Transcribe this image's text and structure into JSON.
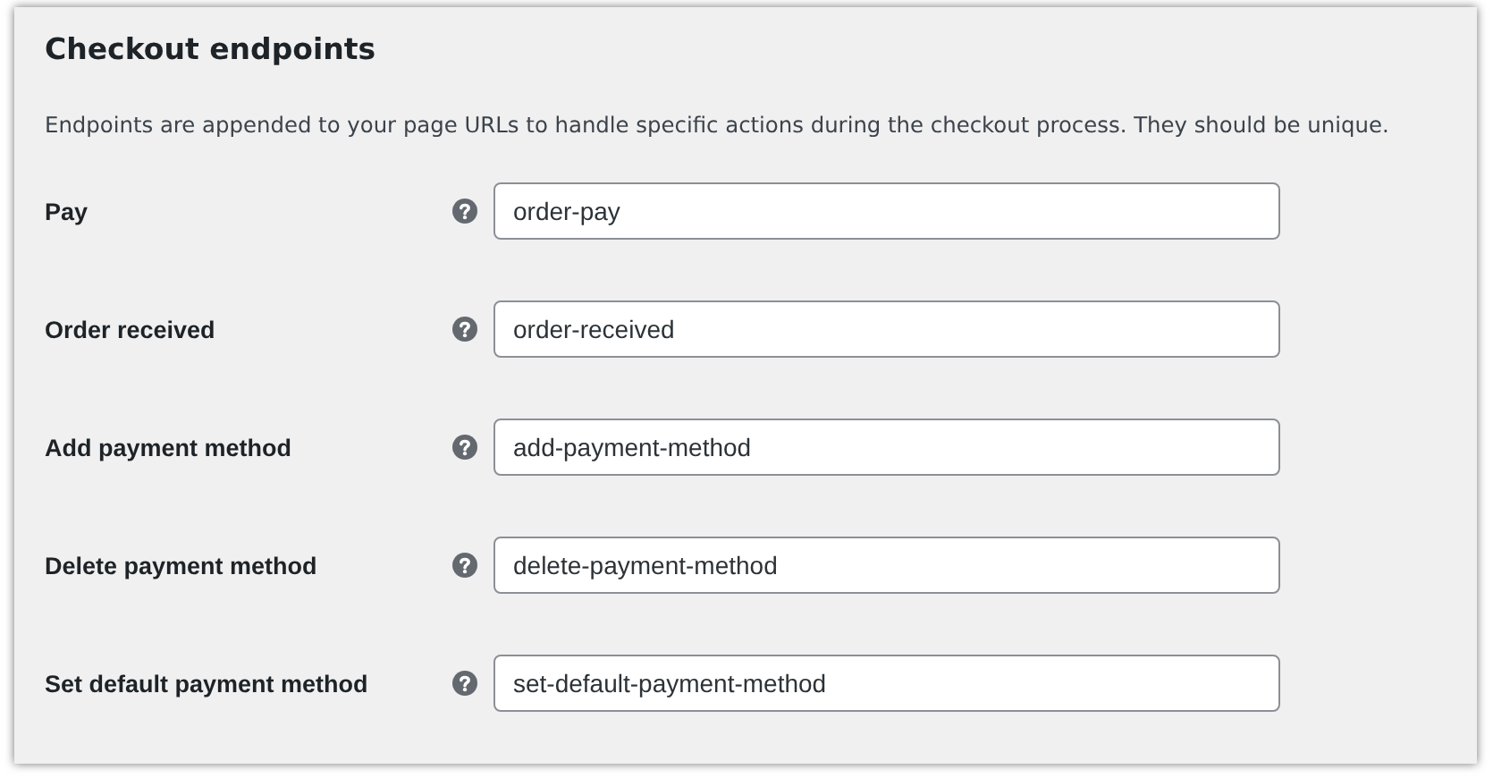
{
  "title": "Checkout endpoints",
  "description": "Endpoints are appended to your page URLs to handle specific actions during the checkout process. They should be unique.",
  "fields": [
    {
      "label": "Pay",
      "value": "order-pay"
    },
    {
      "label": "Order received",
      "value": "order-received"
    },
    {
      "label": "Add payment method",
      "value": "add-payment-method"
    },
    {
      "label": "Delete payment method",
      "value": "delete-payment-method"
    },
    {
      "label": "Set default payment method",
      "value": "set-default-payment-method"
    }
  ]
}
